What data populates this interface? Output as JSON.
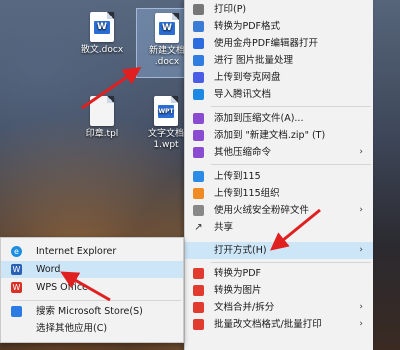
{
  "desktop": {
    "icons": [
      {
        "label": "散文.docx",
        "type": "word"
      },
      {
        "label": "新建文档.docx",
        "type": "word",
        "selected": true
      },
      {
        "label": "印章.tpl",
        "type": "blank"
      },
      {
        "label": "文字文档1.wpt",
        "type": "wps"
      }
    ],
    "new_doc_line1": "新建文档",
    "new_doc_line2": ".docx",
    "wpt_line1": "文字文档",
    "wpt_line2": "1.wpt",
    "wps_badge": "WPT",
    "word_badge": "W"
  },
  "context_menu": {
    "items": [
      {
        "label": "打印(P)",
        "icon": "printer-icon"
      },
      {
        "label": "转换为PDF格式",
        "icon": "pdf-convert-icon"
      },
      {
        "label": "使用金舟PDF编辑器打开",
        "icon": "pdf-editor-icon"
      },
      {
        "label": "进行 图片批量处理",
        "icon": "image-batch-icon"
      },
      {
        "label": "上传到夸克网盘",
        "icon": "quark-cloud-icon"
      },
      {
        "label": "导入腾讯文档",
        "icon": "tencent-docs-icon"
      },
      {
        "label": "添加到压缩文件(A)...",
        "icon": "archive-icon"
      },
      {
        "label": "添加到 \"新建文档.zip\" (T)",
        "icon": "zip-icon"
      },
      {
        "label": "其他压缩命令",
        "icon": "archive-more-icon",
        "submenu": true
      },
      {
        "label": "上传到115",
        "icon": "cloud115-icon"
      },
      {
        "label": "上传到115组织",
        "icon": "cloud115-org-icon"
      },
      {
        "label": "使用火绒安全粉碎文件",
        "icon": "shredder-icon",
        "submenu": true
      },
      {
        "label": "共享",
        "icon": "share-icon"
      },
      {
        "label": "打开方式(H)",
        "icon": "",
        "submenu": true,
        "highlighted": true
      },
      {
        "label": "转换为PDF",
        "icon": "to-pdf-icon"
      },
      {
        "label": "转换为图片",
        "icon": "to-image-icon"
      },
      {
        "label": "文档合并/拆分",
        "icon": "merge-split-icon",
        "submenu": true
      },
      {
        "label": "批量改文档格式/批量打印",
        "icon": "batch-format-icon",
        "submenu": true
      }
    ],
    "arrow_glyph": "›"
  },
  "open_with_menu": {
    "items": [
      {
        "label": "Internet Explorer",
        "icon": "internet-explorer-icon"
      },
      {
        "label": "Word",
        "icon": "word-icon",
        "highlighted": true
      },
      {
        "label": "WPS Office",
        "icon": "wps-office-icon"
      },
      {
        "label": "搜索 Microsoft Store(S)",
        "icon": "microsoft-store-icon"
      },
      {
        "label": "选择其他应用(C)",
        "icon": ""
      }
    ]
  },
  "colors": {
    "highlight": "#cde6f7",
    "menu_bg": "#f2f2f2",
    "annotation_arrow": "#e02020"
  }
}
